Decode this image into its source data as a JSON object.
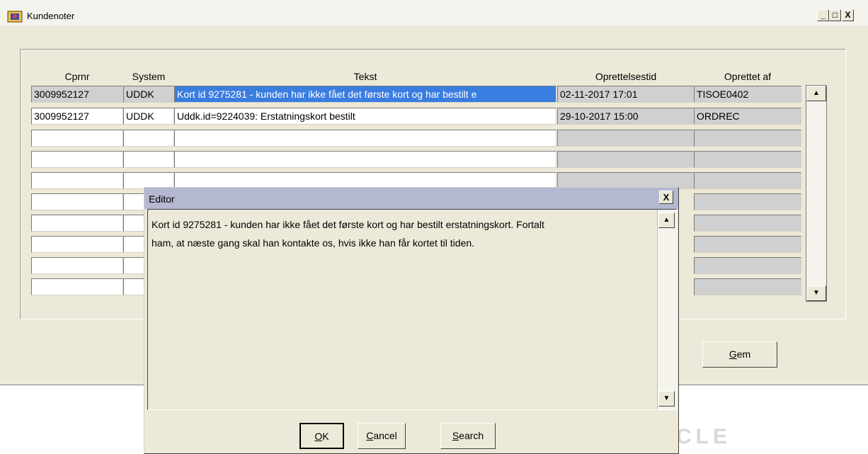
{
  "window": {
    "title": "Kundenoter",
    "minimize_label": "_",
    "maximize_label": "□",
    "close_label": "X"
  },
  "table": {
    "headers": [
      "Cprnr",
      "System",
      "Tekst",
      "Oprettelsestid",
      "Oprettet af"
    ],
    "rows": [
      {
        "cprnr": "3009952127",
        "system": "UDDK",
        "tekst": "Kort id 9275281 - kunden har ikke fået det første kort og har bestilt e",
        "oprettelsestid": "02-11-2017 17:01",
        "oprettet_af": "TISOE0402"
      },
      {
        "cprnr": "3009952127",
        "system": "UDDK",
        "tekst": "Uddk.id=9224039: Erstatningskort bestilt",
        "oprettelsestid": "29-10-2017 15:00",
        "oprettet_af": "ORDREC"
      }
    ]
  },
  "scroll": {
    "up_icon": "▲",
    "down_icon": "▼"
  },
  "buttons": {
    "gem_prefix": "G",
    "gem_rest": "em"
  },
  "logo": {
    "text": "CLE"
  },
  "editor": {
    "title": "Editor",
    "close_label": "X",
    "text_line1": "Kort id 9275281 - kunden har ikke fået det første kort og har bestilt erstatningskort. Fortalt",
    "text_line2": "ham, at næste gang skal han kontakte os, hvis ikke han får kortet til tiden.",
    "ok_prefix": "O",
    "ok_rest": "K",
    "cancel_prefix": "C",
    "cancel_rest": "ancel",
    "search_prefix": "S",
    "search_rest": "earch"
  },
  "colors": {
    "selection": "#3a7de0",
    "window_bg": "#ece9d8",
    "editor_title_bg": "#b4b8d0"
  }
}
